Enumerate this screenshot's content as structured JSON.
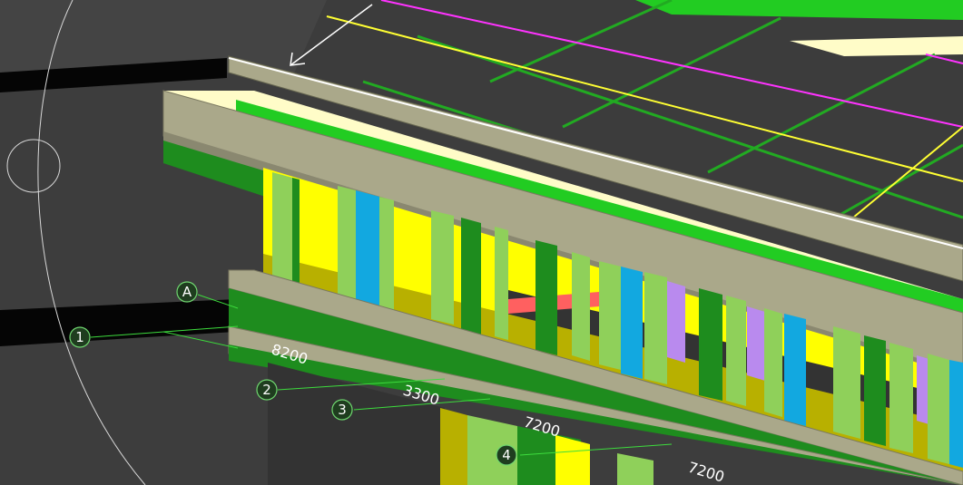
{
  "viewport": {
    "background": "#3d3d3d",
    "colors": {
      "steel_green": "#1e8c1e",
      "bright_green": "#22cc22",
      "light_green": "#8fd05a",
      "concrete_beige": "#aaa88a",
      "yellow": "#ffff00",
      "olive": "#b8b000",
      "cyan": "#12a8e0",
      "purple": "#b98aee",
      "magenta_line": "#ff33ff",
      "yellow_line": "#ffff33",
      "cream": "#fffcc8"
    }
  },
  "grid_bubbles": [
    {
      "id": "A",
      "label": "A"
    },
    {
      "id": "1",
      "label": "1"
    },
    {
      "id": "2",
      "label": "2"
    },
    {
      "id": "3",
      "label": "3"
    },
    {
      "id": "4",
      "label": "4"
    }
  ],
  "dimensions": [
    {
      "id": "d1",
      "label": "8200"
    },
    {
      "id": "d2",
      "label": "3300"
    },
    {
      "id": "d3",
      "label": "7200"
    },
    {
      "id": "d4",
      "label": "7200"
    }
  ]
}
